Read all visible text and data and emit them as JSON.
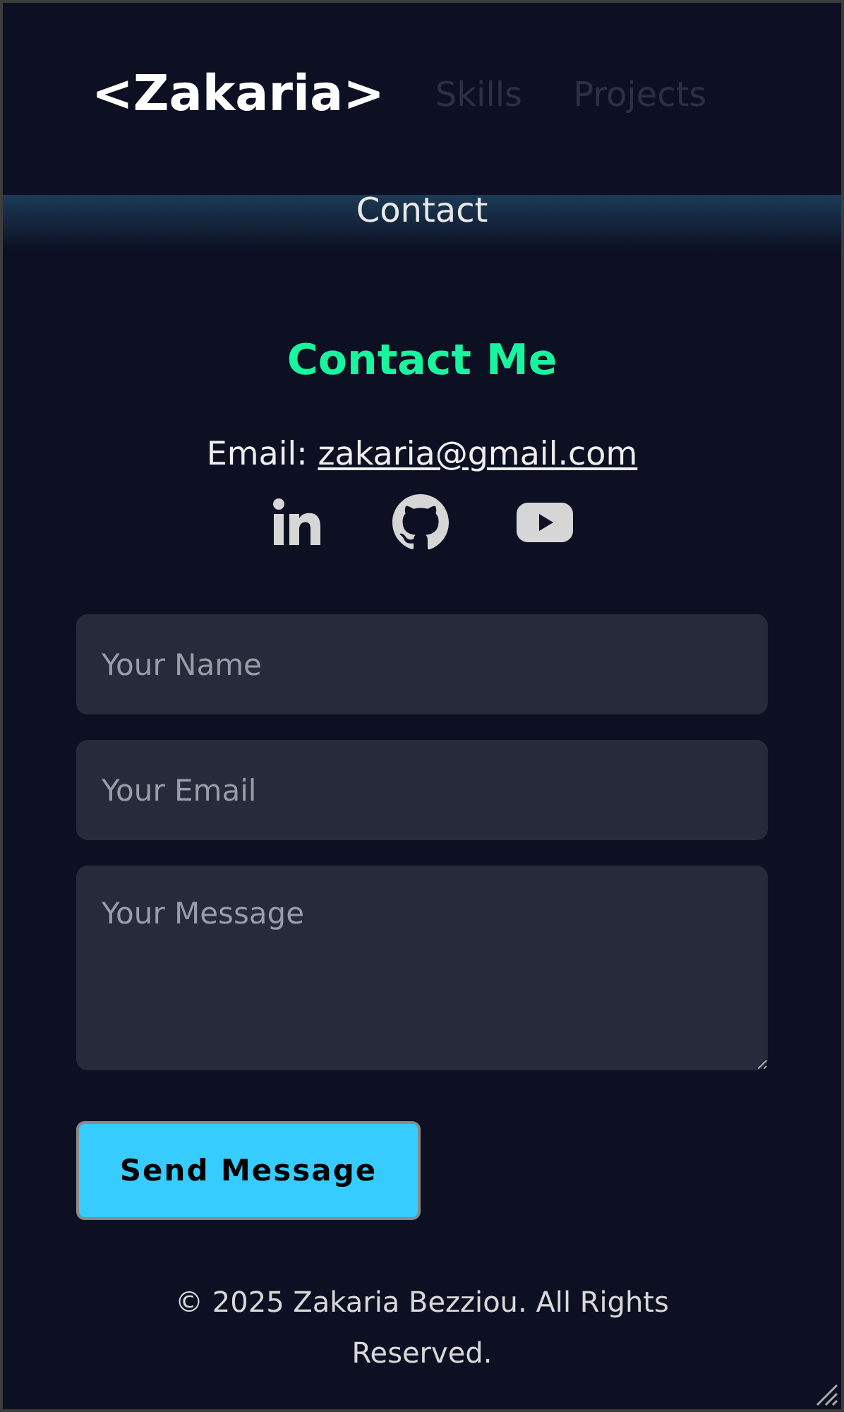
{
  "header": {
    "logo": "<Zakaria>",
    "nav": [
      {
        "label": "Skills"
      },
      {
        "label": "Projects"
      },
      {
        "label": "Contact"
      }
    ]
  },
  "contact": {
    "title": "Contact Me",
    "email_label": "Email:",
    "email": "zakaria@gmail.com",
    "socials": [
      {
        "kind": "linkedin"
      },
      {
        "kind": "github"
      },
      {
        "kind": "youtube"
      }
    ],
    "fields": [
      {
        "kind": "input",
        "placeholder": "Your Name"
      },
      {
        "kind": "input",
        "placeholder": "Your Email"
      },
      {
        "kind": "textarea",
        "placeholder": "Your Message"
      }
    ],
    "button": "Send Message"
  },
  "footer": {
    "text": "© 2025 Zakaria Bezziou. All Rights Reserved."
  }
}
